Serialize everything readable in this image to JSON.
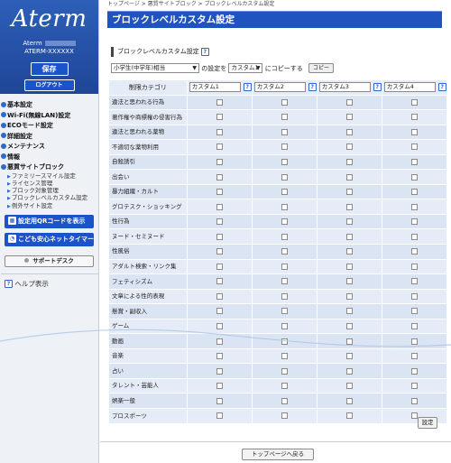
{
  "brand": {
    "logo": "Aterm",
    "model_line1": "Aterm",
    "model_line2": "ATERM-XXXXXX"
  },
  "sidebar": {
    "save_label": "保存",
    "logout_label": "ログアウト",
    "menu": [
      {
        "label": "基本設定"
      },
      {
        "label": "Wi-Fi(無線LAN)設定"
      },
      {
        "label": "ECOモード設定"
      },
      {
        "label": "詳細設定"
      },
      {
        "label": "メンテナンス"
      },
      {
        "label": "情報"
      },
      {
        "label": "悪質サイトブロック"
      }
    ],
    "submenu": [
      "ファミリースマイル設定",
      "ライセンス管理",
      "ブロック対象管理",
      "ブロックレベルカスタム設定",
      "例外サイト設定"
    ],
    "qr_button": "設定用QRコードを表示",
    "timer_button": "こども安心ネットタイマー",
    "support_button": "サポートデスク",
    "help_label": "ヘルプ表示"
  },
  "breadcrumb": "トップページ > 悪質サイトブロック > ブロックレベルカスタム設定",
  "page_title": "ブロックレベルカスタム設定",
  "section_title": "ブロックレベルカスタム設定",
  "copy_row": {
    "source_select": "小学生(中学年)相当",
    "mid_text": "の設定を",
    "target_select": "カスタム1",
    "suffix_text": "にコピーする",
    "copy_button": "コピー"
  },
  "table": {
    "category_header": "制限カテゴリ",
    "custom_names": [
      "カスタム1",
      "カスタム2",
      "カスタム3",
      "カスタム4"
    ],
    "categories": [
      "違法と思われる行為",
      "著作権や商標権の侵害行為",
      "違法と思われる薬物",
      "不適切な薬物利用",
      "自殺誘引",
      "出会い",
      "暴力組織・カルト",
      "グロテスク・ショッキング",
      "性行為",
      "ヌード・セミヌード",
      "性風俗",
      "アダルト検索・リンク集",
      "フェティシズム",
      "文章による性的表現",
      "懸賞・副収入",
      "ゲーム",
      "動画",
      "音楽",
      "占い",
      "タレント・芸能人",
      "娯楽一般",
      "プロスポーツ"
    ]
  },
  "set_button": "設定",
  "back_button": "トップページへ戻る",
  "colors": {
    "title_blue": "#1f54c0",
    "sidebar_blue": "#2d5fb8",
    "table_bg": "#dbe4f3"
  }
}
